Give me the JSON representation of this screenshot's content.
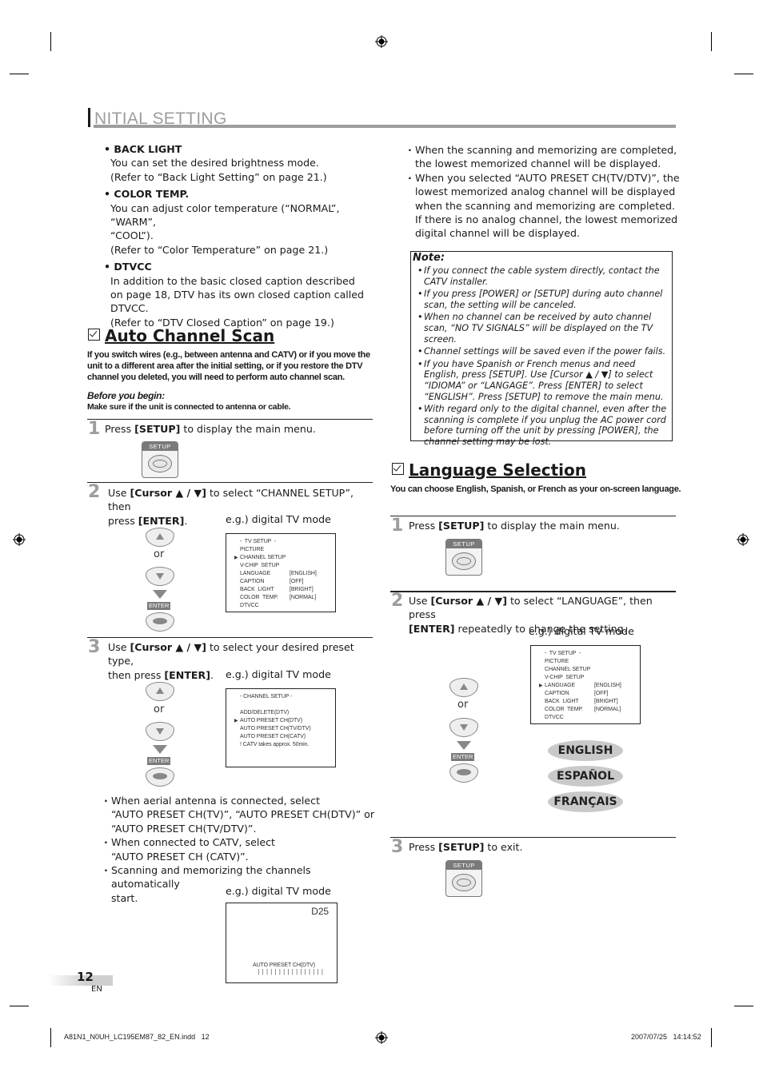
{
  "header": {
    "title_initial": "I",
    "title_rest": "NITIAL  SETTING"
  },
  "intro_bullets": [
    {
      "head": "• BACK LIGHT",
      "lines": [
        "You can set the desired brightness mode.",
        "(Refer to “Back Light Setting” on page 21.)"
      ]
    },
    {
      "head": "• COLOR TEMP.",
      "lines": [
        "You can adjust color temperature (“NORMAL”, “WARM”,",
        "“COOL”).",
        "(Refer to “Color Temperature” on page 21.)"
      ]
    },
    {
      "head": "• DTVCC",
      "lines": [
        "In addition to the basic closed caption described",
        "on page 18, DTV has its own closed caption called",
        "DTVCC.",
        "(Refer to “DTV Closed Caption” on page 19.)"
      ]
    }
  ],
  "auto_scan": {
    "title": "Auto Channel Scan",
    "intro": [
      "If you switch wires (e.g., between antenna and CATV) or if you move the",
      "unit to a different area after the initial setting, or if you restore the DTV",
      "channel you deleted, you will need to perform auto channel scan."
    ],
    "before_label": "Before you begin:",
    "before_text": "Make sure if the unit is connected to antenna or cable.",
    "steps": [
      {
        "num": "1",
        "pre": "Press ",
        "key": "[SETUP]",
        "post": " to display the main menu."
      },
      {
        "num": "2",
        "pre": "Use ",
        "key": "[Cursor ▲ / ▼]",
        "post": " to select “CHANNEL SETUP”, then",
        "line2_pre": "press ",
        "line2_key": "[ENTER]",
        "line2_post": "."
      },
      {
        "num": "3",
        "pre": "Use ",
        "key": "[Cursor ▲ / ▼]",
        "post": " to select your desired preset type,",
        "line2_pre": "then press ",
        "line2_key": "[ENTER]",
        "line2_post": "."
      }
    ],
    "eg_label": "e.g.) digital TV mode",
    "or_label": "or",
    "setup_label": "SETUP",
    "enter_label": "ENTER",
    "menu_tv_setup": {
      "title": "-  TV SETUP  -",
      "items": [
        {
          "label": "PICTURE",
          "value": ""
        },
        {
          "label": "CHANNEL SETUP",
          "value": "",
          "selected": true
        },
        {
          "label": "V-CHIP  SETUP",
          "value": ""
        },
        {
          "label": "LANGUAGE",
          "value": "[ENGLISH]"
        },
        {
          "label": "CAPTION",
          "value": "[OFF]"
        },
        {
          "label": "BACK  LIGHT",
          "value": "[BRIGHT]"
        },
        {
          "label": "COLOR  TEMP.",
          "value": "[NORMAL]"
        },
        {
          "label": "DTVCC",
          "value": ""
        }
      ]
    },
    "menu_channel_setup": {
      "title": "- CHANNEL SETUP -",
      "items": [
        {
          "label": "ADD/DELETE(DTV)"
        },
        {
          "label": "AUTO PRESET CH(DTV)",
          "selected": true
        },
        {
          "label": "AUTO PRESET CH(TV/DTV)"
        },
        {
          "label": "AUTO PRESET CH(CATV)"
        },
        {
          "label": "! CATV takes approx. 50min."
        }
      ]
    },
    "after_bullets": [
      [
        "When aerial antenna is connected, select",
        "“AUTO PRESET CH(TV)”, “AUTO PRESET CH(DTV)” or",
        "“AUTO PRESET CH(TV/DTV)”."
      ],
      [
        "When connected to CATV, select",
        "“AUTO PRESET CH (CATV)”."
      ],
      [
        "Scanning and memorizing the channels automatically",
        "start."
      ]
    ],
    "scan_screen": {
      "channel": "D25",
      "label": "AUTO PRESET CH(DTV)",
      "progress_bar": "||||||||||||||||"
    }
  },
  "right_bullets": [
    [
      "When the scanning and memorizing are completed,",
      "the lowest memorized channel will be displayed."
    ],
    [
      "When you selected “AUTO PRESET CH(TV/DTV)”, the",
      "lowest memorized analog channel will be displayed",
      "when the scanning and memorizing are completed.",
      "If there is no analog channel, the lowest memorized",
      "digital channel will be displayed."
    ]
  ],
  "note": {
    "title": "Note:",
    "items": [
      "If you connect the cable system directly, contact the CATV installer.",
      "If you press [POWER] or [SETUP] during auto channel scan, the setting will be canceled.",
      "When no channel can be received by auto channel scan, “NO TV SIGNALS” will be displayed on the TV screen.",
      "Channel settings will be saved even if the power fails.",
      "If you have Spanish or French menus and need English, press [SETUP]. Use [Cursor ▲ / ▼] to select “IDIOMA” or “LANGAGE”. Press [ENTER] to select “ENGLISH”. Press [SETUP] to remove the main menu.",
      "With regard only to the digital channel, even after the scanning is complete if you unplug the AC power cord before turning off the unit by pressing [POWER], the channel setting may be lost."
    ]
  },
  "language": {
    "title": "Language Selection",
    "intro": "You can choose English, Spanish, or French as your on-screen language.",
    "steps": [
      {
        "num": "1",
        "pre": "Press ",
        "key": "[SETUP]",
        "post": " to display the main menu."
      },
      {
        "num": "2",
        "pre": "Use ",
        "key": "[Cursor ▲ / ▼]",
        "post": " to select “LANGUAGE”, then press",
        "line2_pre": "",
        "line2_key": "[ENTER]",
        "line2_post": " repeatedly to change the setting."
      },
      {
        "num": "3",
        "pre": "Press ",
        "key": "[SETUP]",
        "post": " to exit."
      }
    ],
    "eg_label": "e.g.) digital TV mode",
    "menu_tv_setup": {
      "title": "-  TV SETUP  -",
      "items": [
        {
          "label": "PICTURE",
          "value": ""
        },
        {
          "label": "CHANNEL SETUP",
          "value": ""
        },
        {
          "label": "V-CHIP  SETUP",
          "value": ""
        },
        {
          "label": "LANGUAGE",
          "value": "[ENGLISH]",
          "selected": true
        },
        {
          "label": "CAPTION",
          "value": "[OFF]"
        },
        {
          "label": "BACK  LIGHT",
          "value": "[BRIGHT]"
        },
        {
          "label": "COLOR  TEMP.",
          "value": "[NORMAL]"
        },
        {
          "label": "DTVCC",
          "value": ""
        }
      ]
    },
    "options": [
      "ENGLISH",
      "ESPAÑOL",
      "FRANÇAIS"
    ]
  },
  "page": {
    "number": "12",
    "lang": "EN"
  },
  "footer": {
    "file": "A81N1_N0UH_LC195EM87_82_EN.indd   12",
    "timestamp": "2007/07/25   14:14:52"
  }
}
